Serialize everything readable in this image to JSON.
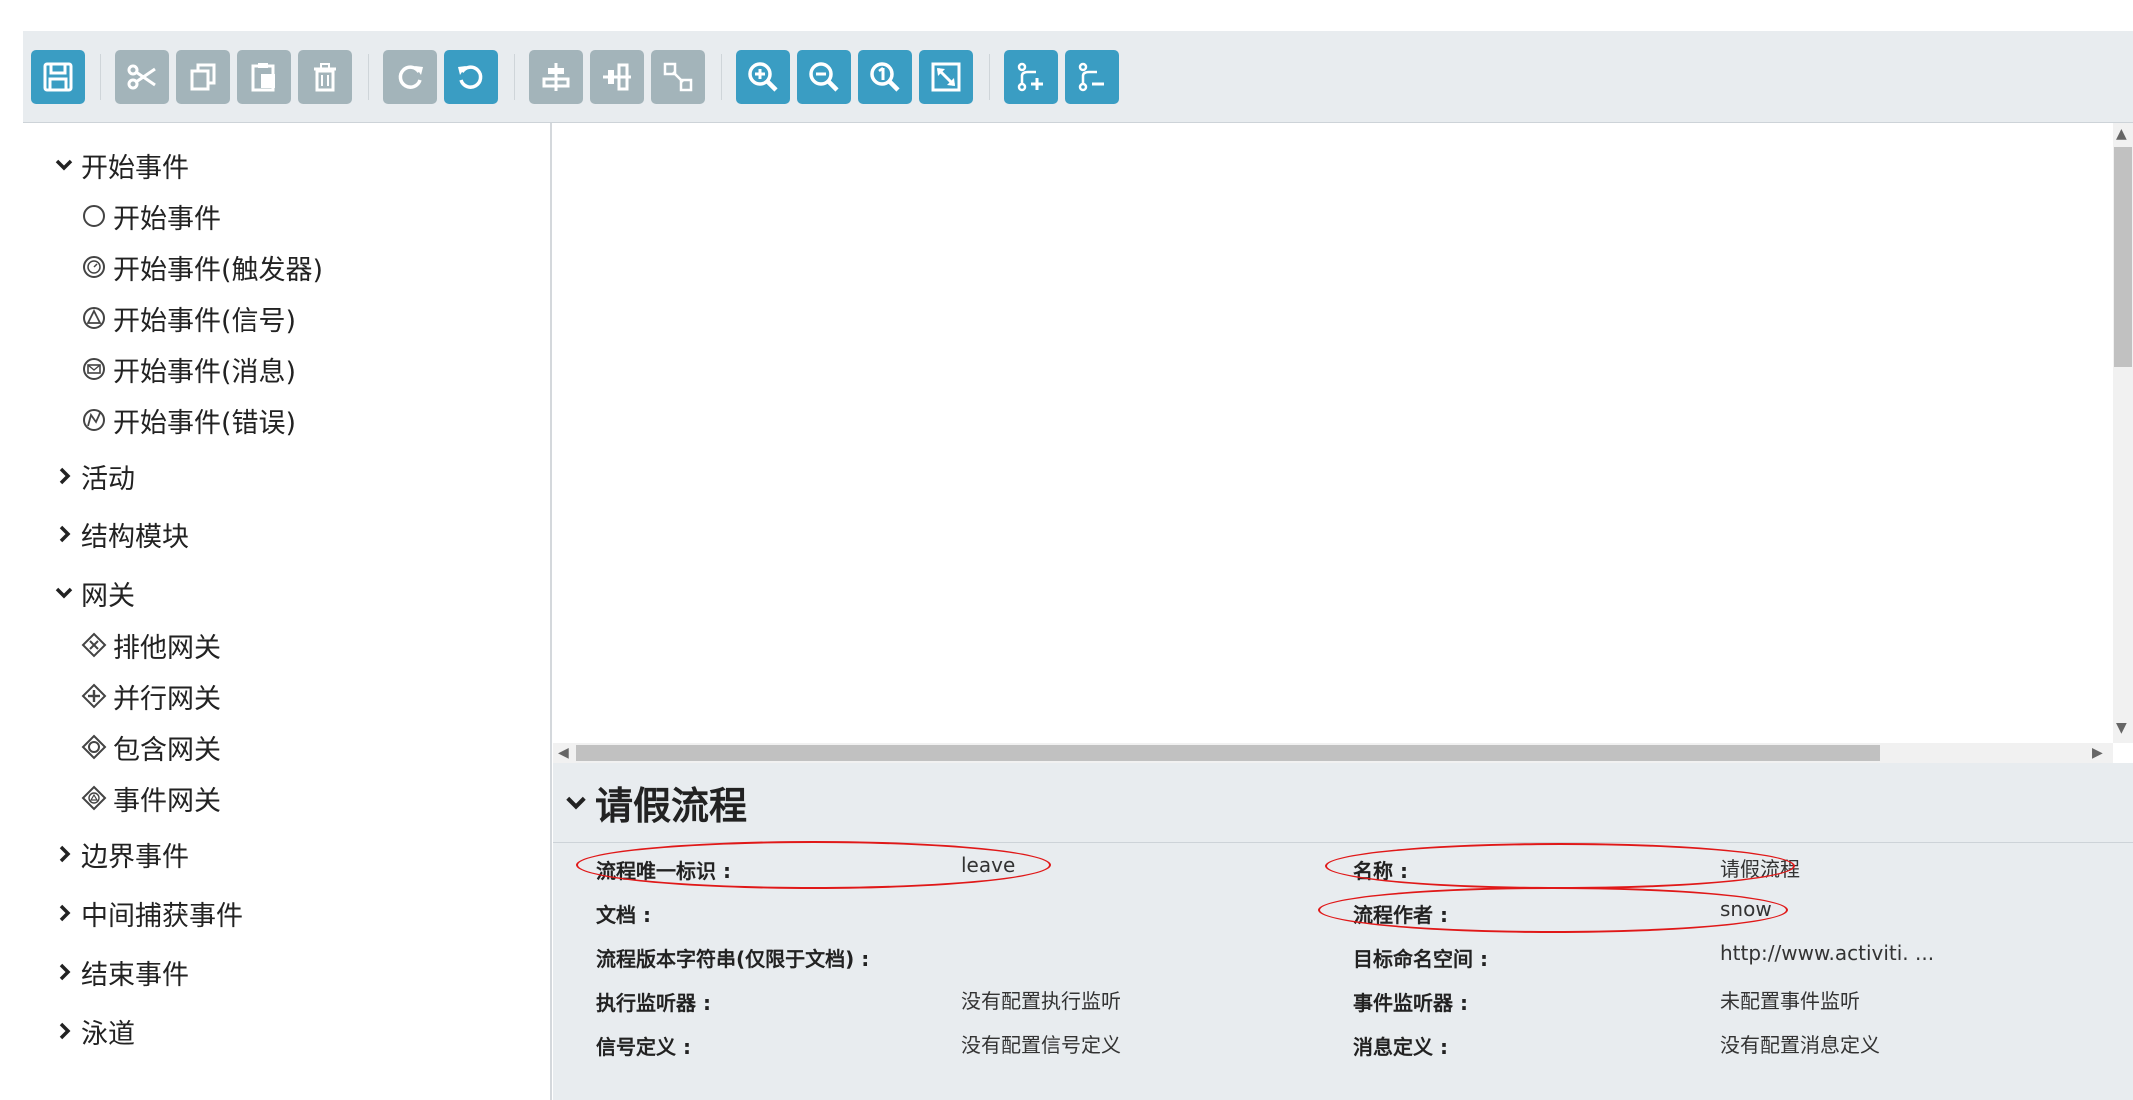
{
  "toolbar": {
    "buttons": [
      {
        "name": "save-icon",
        "tooltip": ""
      },
      {
        "name": "cut-icon"
      },
      {
        "name": "copy-icon"
      },
      {
        "name": "paste-icon"
      },
      {
        "name": "delete-icon"
      },
      {
        "name": "redo-icon"
      },
      {
        "name": "undo-icon"
      },
      {
        "name": "align-horizontal-icon"
      },
      {
        "name": "align-vertical-icon"
      },
      {
        "name": "same-size-icon"
      },
      {
        "name": "zoom-in-icon"
      },
      {
        "name": "zoom-out-icon"
      },
      {
        "name": "zoom-actual-icon"
      },
      {
        "name": "zoom-fit-icon"
      },
      {
        "name": "add-bendpoint-icon"
      },
      {
        "name": "remove-bendpoint-icon"
      }
    ],
    "colors": {
      "primary": "#3a9dc3",
      "disabled": "#a3b4ba"
    }
  },
  "palette": {
    "groups": [
      {
        "label": "开始事件",
        "expanded": true,
        "items": [
          {
            "label": "开始事件",
            "icon": "circle-icon"
          },
          {
            "label": "开始事件(触发器)",
            "icon": "timer-icon"
          },
          {
            "label": "开始事件(信号)",
            "icon": "signal-icon"
          },
          {
            "label": "开始事件(消息)",
            "icon": "message-icon"
          },
          {
            "label": "开始事件(错误)",
            "icon": "error-icon"
          }
        ]
      },
      {
        "label": "活动",
        "expanded": false
      },
      {
        "label": "结构模块",
        "expanded": false
      },
      {
        "label": "网关",
        "expanded": true,
        "items": [
          {
            "label": "排他网关",
            "icon": "exclusive-gateway-icon"
          },
          {
            "label": "并行网关",
            "icon": "parallel-gateway-icon"
          },
          {
            "label": "包含网关",
            "icon": "inclusive-gateway-icon"
          },
          {
            "label": "事件网关",
            "icon": "event-gateway-icon"
          }
        ]
      },
      {
        "label": "边界事件",
        "expanded": false
      },
      {
        "label": "中间捕获事件",
        "expanded": false
      },
      {
        "label": "结束事件",
        "expanded": false
      },
      {
        "label": "泳道",
        "expanded": false
      }
    ]
  },
  "properties": {
    "title": "请假流程",
    "left": [
      {
        "label": "流程唯一标识 :",
        "value": "leave",
        "highlighted": true
      },
      {
        "label": "文档 :",
        "value": ""
      },
      {
        "label": "流程版本字符串(仅限于文档) :",
        "value": ""
      },
      {
        "label": "执行监听器 :",
        "value": "没有配置执行监听"
      },
      {
        "label": "信号定义 :",
        "value": "没有配置信号定义"
      }
    ],
    "right": [
      {
        "label": "名称 :",
        "value": "请假流程",
        "highlighted": true
      },
      {
        "label": "流程作者 :",
        "value": "snow",
        "highlighted": true
      },
      {
        "label": "目标命名空间 :",
        "value": "http://www.activiti. ..."
      },
      {
        "label": "事件监听器 :",
        "value": "未配置事件监听"
      },
      {
        "label": "消息定义 :",
        "value": "没有配置消息定义"
      }
    ],
    "highlight_color": "#e01818"
  }
}
